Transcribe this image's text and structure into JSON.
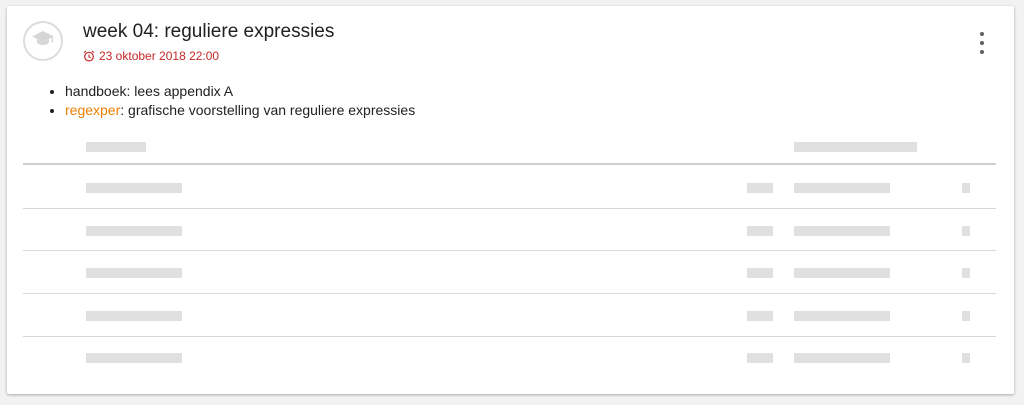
{
  "assignment": {
    "title": "week 04: reguliere expressies",
    "deadline": "23 oktober 2018 22:00",
    "icon": "graduation-cap-icon",
    "description": {
      "item1": "handboek: lees appendix A",
      "item2_link": "regexper",
      "item2_rest": ": grafische voorstelling van reguliere expressies"
    }
  },
  "colors": {
    "deadline": "#c62828",
    "link": "#ef7d00",
    "placeholder": "#e0e0e0"
  },
  "table": {
    "loading": true,
    "row_count": 5
  }
}
